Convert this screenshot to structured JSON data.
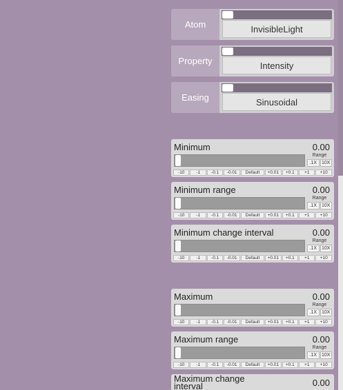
{
  "choosers": [
    {
      "label": "Atom",
      "value": "InvisibleLight"
    },
    {
      "label": "Property",
      "value": "Intensity"
    },
    {
      "label": "Easing",
      "value": "Sinusoidal"
    }
  ],
  "sliders": [
    {
      "name": "Minimum",
      "value": "0.00"
    },
    {
      "name": "Minimum range",
      "value": "0.00"
    },
    {
      "name": "Minimum change interval",
      "value": "0.00"
    },
    {
      "name": "Maximum",
      "value": "0.00"
    },
    {
      "name": "Maximum range",
      "value": "0.00"
    },
    {
      "name": "Maximum change interval",
      "value": "0.00"
    }
  ],
  "range": {
    "label": "Range",
    "down": ".1X",
    "up": "10X"
  },
  "steps": [
    "-10",
    "-1",
    "-0.1",
    "-0.01",
    "Default",
    "+0.01",
    "+0.1",
    "+1",
    "+10"
  ]
}
